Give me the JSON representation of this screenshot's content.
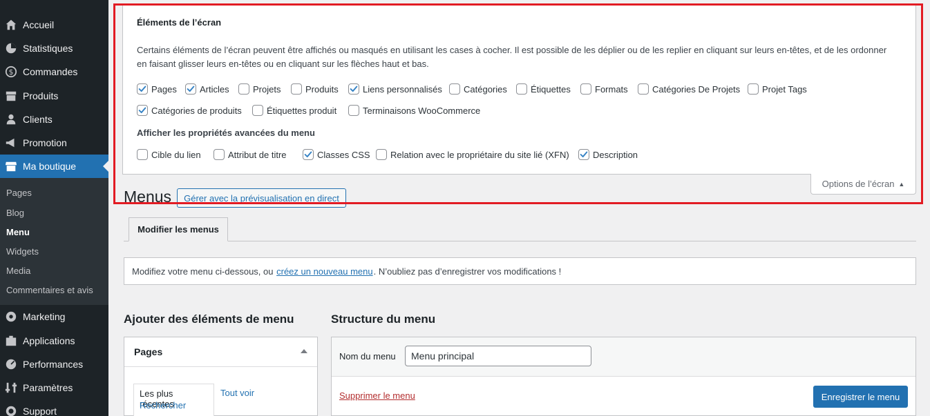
{
  "sidebar": {
    "items": [
      {
        "label": "Accueil",
        "icon": "dashboard-icon"
      },
      {
        "label": "Statistiques",
        "icon": "analytics-icon"
      },
      {
        "label": "Commandes",
        "icon": "dollar-icon"
      },
      {
        "label": "Produits",
        "icon": "archive-icon"
      },
      {
        "label": "Clients",
        "icon": "user-icon"
      },
      {
        "label": "Promotion",
        "icon": "megaphone-icon"
      },
      {
        "label": "Ma boutique",
        "icon": "store-icon"
      },
      {
        "label": "Marketing",
        "icon": "marketing-icon"
      },
      {
        "label": "Applications",
        "icon": "apps-icon"
      },
      {
        "label": "Performances",
        "icon": "performance-icon"
      },
      {
        "label": "Paramètres",
        "icon": "settings-icon"
      },
      {
        "label": "Support",
        "icon": "support-icon"
      }
    ],
    "submenu": [
      "Pages",
      "Blog",
      "Menu",
      "Widgets",
      "Media",
      "Commentaires et avis"
    ],
    "active_color": "#2271b1"
  },
  "screen_options": {
    "title": "Éléments de l’écran",
    "description": "Certains éléments de l’écran peuvent être affichés ou masqués en utilisant les cases à cocher. Il est possible de les déplier ou de les replier en cliquant sur leurs en-têtes, et de les ordonner en faisant glisser leurs en-têtes ou en cliquant sur les flèches haut et bas.",
    "boxes": [
      {
        "label": "Pages",
        "checked": true
      },
      {
        "label": "Articles",
        "checked": true
      },
      {
        "label": "Projets",
        "checked": false
      },
      {
        "label": "Produits",
        "checked": false
      },
      {
        "label": "Liens personnalisés",
        "checked": true
      },
      {
        "label": "Catégories",
        "checked": false
      },
      {
        "label": "Étiquettes",
        "checked": false
      },
      {
        "label": "Formats",
        "checked": false
      },
      {
        "label": "Catégories De Projets",
        "checked": false
      },
      {
        "label": "Projet Tags",
        "checked": false
      },
      {
        "label": "Catégories de produits",
        "checked": true
      },
      {
        "label": "Étiquettes produit",
        "checked": false
      },
      {
        "label": "Terminaisons WooCommerce",
        "checked": false
      }
    ],
    "advanced_title": "Afficher les propriétés avancées du menu",
    "advanced": [
      {
        "label": "Cible du lien",
        "checked": false
      },
      {
        "label": "Attribut de titre",
        "checked": false
      },
      {
        "label": "Classes CSS",
        "checked": true
      },
      {
        "label": "Relation avec le propriétaire du site lié (XFN)",
        "checked": false
      },
      {
        "label": "Description",
        "checked": true
      }
    ],
    "toggle_label": "Options de l’écran",
    "highlight_color": "#e21b23"
  },
  "header": {
    "title": "Menus",
    "live_button": "Gérer avec la prévisualisation en direct"
  },
  "tabs": {
    "edit": "Modifier les menus"
  },
  "notice": {
    "before": "Modifiez votre menu ci-dessous, ou",
    "link": "créez un nouveau menu",
    "after": ". N’oubliez pas d’enregistrer vos modifications !"
  },
  "add_items": {
    "title": "Ajouter des éléments de menu",
    "pages_box": "Pages",
    "tab_recent": "Les plus récentes",
    "tab_all": "Tout voir",
    "tab_search": "Rechercher"
  },
  "structure": {
    "title": "Structure du menu",
    "name_label": "Nom du menu",
    "name_value": "Menu principal",
    "delete_link": "Supprimer le menu",
    "save_button": "Enregistrer le menu"
  }
}
